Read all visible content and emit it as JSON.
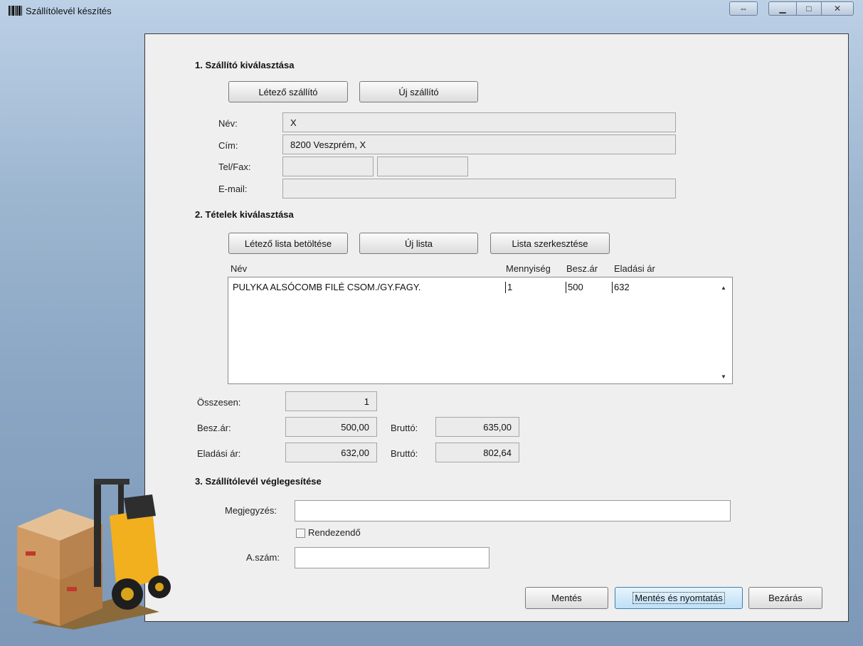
{
  "window": {
    "title": "Szállítólevél készítés",
    "controls": [
      "resize-icon",
      "minimize-icon",
      "maximize-icon",
      "close-icon"
    ]
  },
  "section1": {
    "title": "1. Szállító kiválasztása",
    "existing_btn": "Létező szállító",
    "new_btn": "Új szállító",
    "name_label": "Név:",
    "name_value": "X",
    "address_label": "Cím:",
    "address_value": "8200 Veszprém, X",
    "telfax_label": "Tel/Fax:",
    "tel_value": "",
    "fax_value": "",
    "email_label": "E-mail:",
    "email_value": ""
  },
  "section2": {
    "title": "2. Tételek kiválasztása",
    "load_btn": "Létező lista betöltése",
    "new_btn": "Új lista",
    "edit_btn": "Lista szerkesztése",
    "columns": [
      "Név",
      "Mennyiség",
      "Besz.ár",
      "Eladási ár"
    ],
    "rows": [
      {
        "name": "PULYKA  ALSÓCOMB FILÉ  CSOM./GY.FAGY.",
        "qty": "1",
        "buy": "500",
        "sell": "632"
      }
    ],
    "total_label": "Összesen:",
    "total_value": "1",
    "buy_label": "Besz.ár:",
    "buy_value": "500,00",
    "buy_gross_label": "Bruttó:",
    "buy_gross_value": "635,00",
    "sell_label": "Eladási ár:",
    "sell_value": "632,00",
    "sell_gross_label": "Bruttó:",
    "sell_gross_value": "802,64"
  },
  "section3": {
    "title": "3. Szállítólevél véglegesítése",
    "note_label": "Megjegyzés:",
    "note_value": "",
    "checkbox_label": "Rendezendő",
    "checkbox_checked": false,
    "number_label": "A.szám:",
    "number_value": ""
  },
  "actions": {
    "save": "Mentés",
    "save_print": "Mentés és nyomtatás",
    "close": "Bezárás"
  }
}
